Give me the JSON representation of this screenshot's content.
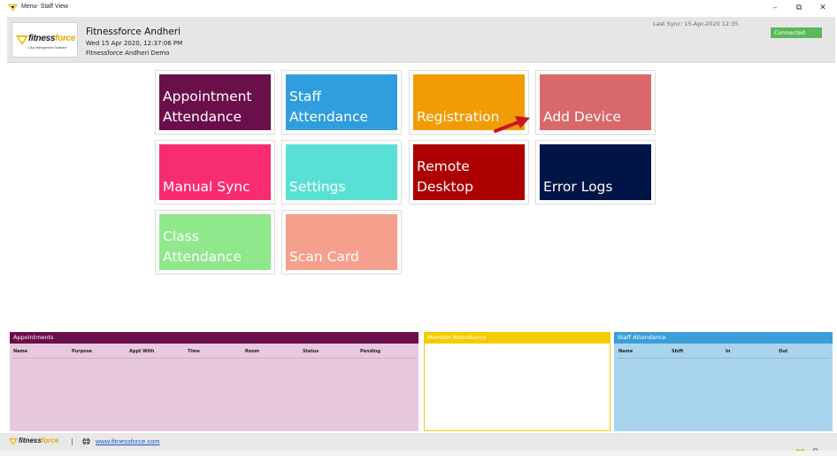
{
  "window": {
    "title": "Menu- Staff View",
    "minimize": "–",
    "restore": "⧉",
    "close": "✕"
  },
  "header": {
    "logo_word_fitness": "fitness",
    "logo_word_force": "force",
    "logo_tagline": "Club Management Software",
    "club_name": "Fitnessforce Andheri",
    "date_time": "Wed 15 Apr 2020, 12:37:06 PM",
    "branch_label": "Fitnessforce Andheri Demo",
    "last_sync": "Last Sync:  15-Apr-2020 12:35",
    "connection_status": "Connected"
  },
  "tiles": [
    {
      "label": "Appointment\nAttendance",
      "color": "#6b0f4b"
    },
    {
      "label": "Staff\nAttendance",
      "color": "#2e9ede"
    },
    {
      "label": "Registration",
      "color": "#f29b05"
    },
    {
      "label": "Add Device",
      "color": "#d9686a"
    },
    {
      "label": "Manual Sync",
      "color": "#f72c73"
    },
    {
      "label": "Settings",
      "color": "#59e0d5"
    },
    {
      "label": "Remote\nDesktop",
      "color": "#ad0000"
    },
    {
      "label": "Error Logs",
      "color": "#001446"
    },
    {
      "label": "Class\nAttendance",
      "color": "#8fe88c"
    },
    {
      "label": "Scan Card",
      "color": "#f5a08c"
    }
  ],
  "panels": {
    "appointments": {
      "title": "Appointments",
      "header_color": "#6b0f4b",
      "body_color": "#e8c8df",
      "columns": [
        "Name",
        "Purpose",
        "Appt With",
        "Time",
        "Room",
        "Status",
        "Pending"
      ]
    },
    "member_attendance": {
      "title": "Member Attendance",
      "header_color": "#f5cc00",
      "body_color": "#ffffff"
    },
    "staff_attendance": {
      "title": "Staff Attendance",
      "header_color": "#3a9fd9",
      "body_color": "#a9d4ee",
      "columns": [
        "Name",
        "Shift",
        "In",
        "Out"
      ]
    }
  },
  "footer": {
    "logo_word_fitness": "fitness",
    "logo_word_force": "force",
    "separator": "|",
    "website": "www.fitnessforce.com",
    "icons": [
      "mail-icon",
      "phone-icon",
      "settings-icon"
    ]
  }
}
